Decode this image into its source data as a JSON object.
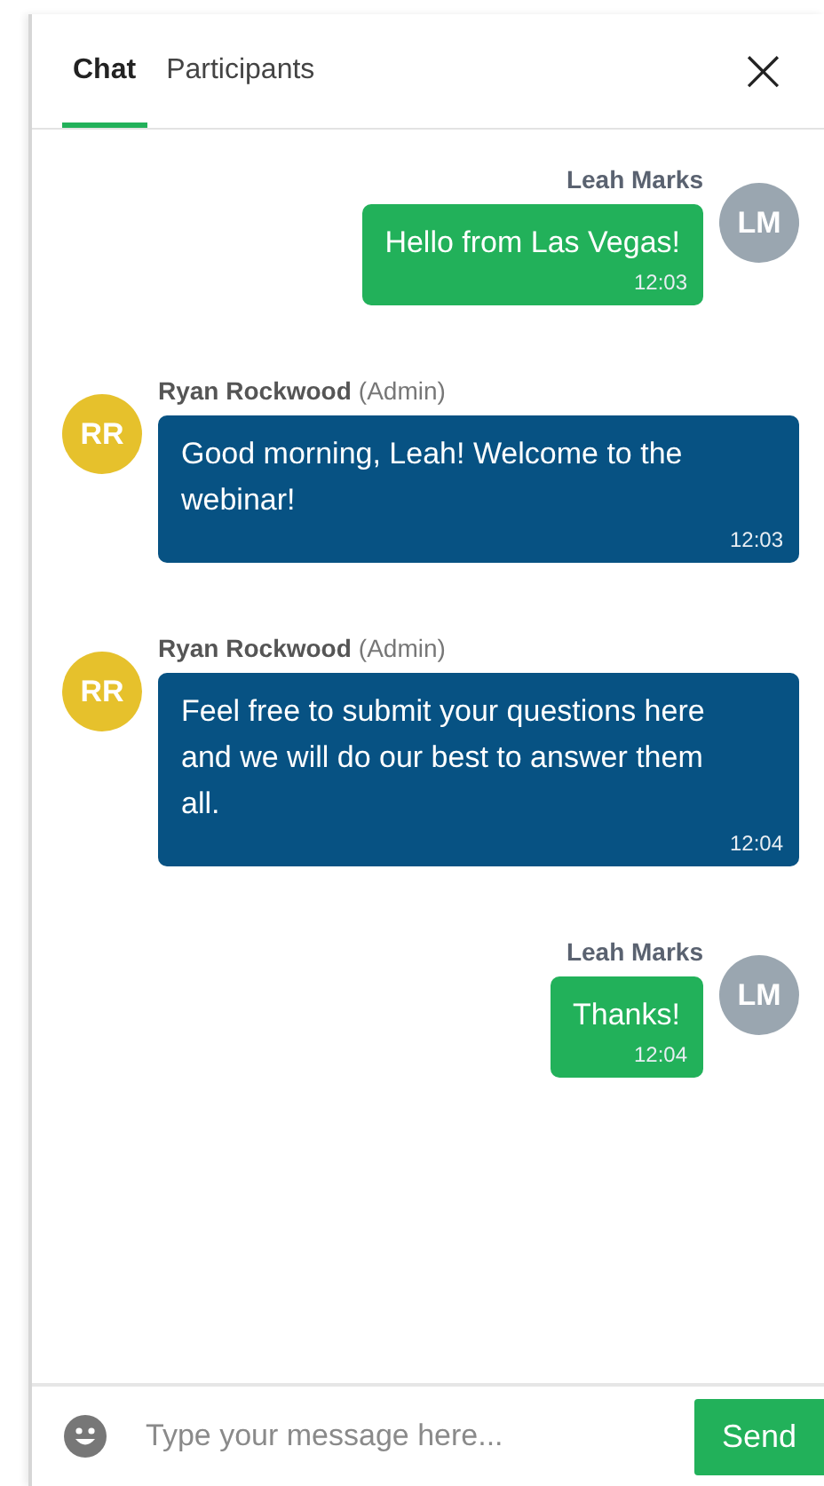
{
  "tabs": [
    {
      "label": "Chat",
      "selected": true
    },
    {
      "label": "Participants",
      "selected": false
    }
  ],
  "close_label": "×",
  "messages": [
    {
      "kind": "own",
      "sender": "Leah Marks",
      "initials": "LM",
      "color": "#9aa6b0",
      "text": "Hello from Las Vegas!",
      "time": "12:03"
    },
    {
      "kind": "other",
      "sender": "Ryan Rockwood",
      "role": "(Admin)",
      "initials": "RR",
      "color": "#e6c12c",
      "text": "Good morning, Leah! Welcome to the webinar!",
      "time": "12:03"
    },
    {
      "kind": "other",
      "sender": "Ryan Rockwood",
      "role": "(Admin)",
      "initials": "RR",
      "color": "#e6c12c",
      "text": "Feel free to submit your questions here and we will do our best to answer them all.",
      "time": "12:04"
    },
    {
      "kind": "own",
      "sender": "Leah Marks",
      "initials": "LM",
      "color": "#9aa6b0",
      "text": "Thanks!",
      "time": "12:04"
    }
  ],
  "composer": {
    "placeholder": "Type your message here...",
    "send_label": "Send"
  }
}
